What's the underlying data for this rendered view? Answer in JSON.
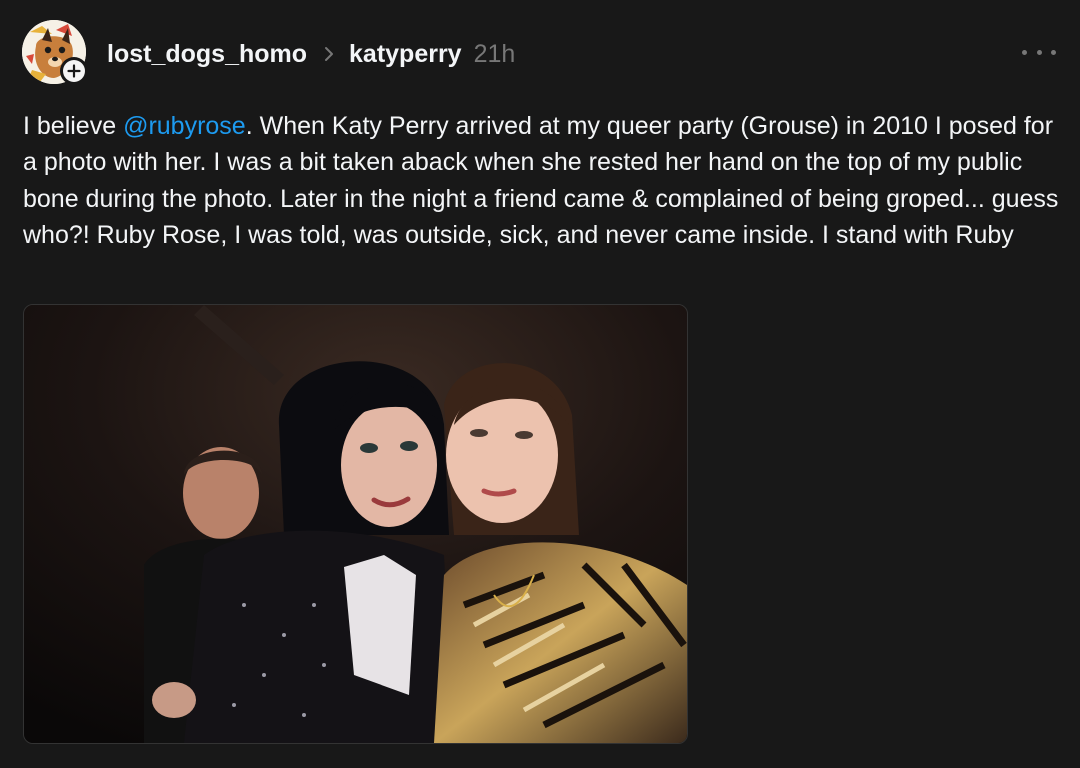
{
  "post": {
    "author": "lost_dogs_homo",
    "reply_to": "katyperry",
    "time": "21h",
    "text_before": "I believe ",
    "mention": "@rubyrose",
    "text_after": ". When Katy Perry arrived at my queer party (Grouse) in 2010 I posed for a photo with her. I was a bit taken aback when she rested her hand on the top of my public bone during the photo. Later in the night a friend came & complained of being groped... guess who?! Ruby Rose, I was told, was outside, sick, and never came inside. I stand with Ruby",
    "icons": {
      "avatar": "dog-avatar-icon",
      "follow": "plus-icon",
      "separator": "chevron-right-icon",
      "menu": "more-icon"
    }
  },
  "colors": {
    "background": "#181818",
    "text": "#f3f5f7",
    "muted": "#777777",
    "link": "#1d9bf0"
  }
}
